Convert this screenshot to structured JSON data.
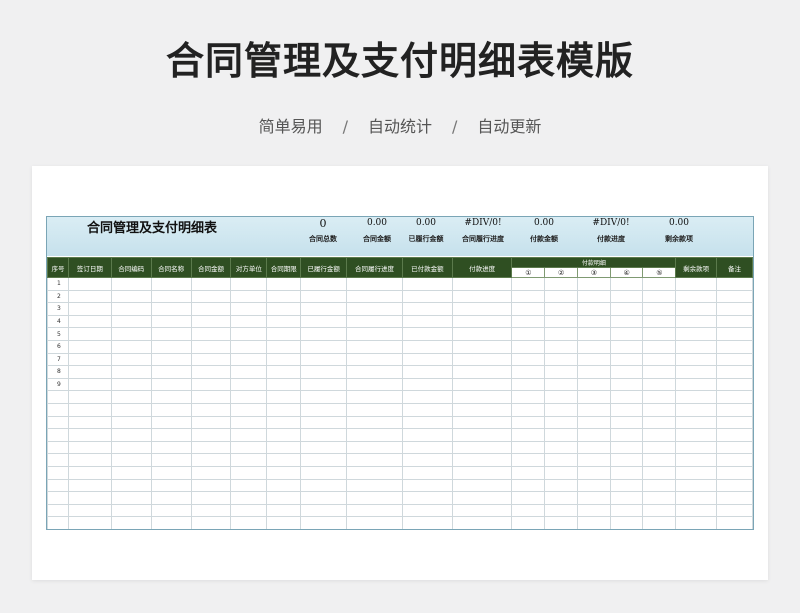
{
  "header": {
    "title": "合同管理及支付明细表模版",
    "features": [
      "简单易用",
      "自动统计",
      "自动更新"
    ],
    "separator": "/"
  },
  "sheet": {
    "title": "合同管理及支付明细表",
    "summary": [
      {
        "value": "0",
        "label": "合同总数"
      },
      {
        "value": "0.00",
        "label": "合同金额"
      },
      {
        "value": "0.00",
        "label": "已履行金额"
      },
      {
        "value": "#DIV/0!",
        "label": "合同履行进度"
      },
      {
        "value": "0.00",
        "label": "付款金额"
      },
      {
        "value": "#DIV/0!",
        "label": "付款进度"
      },
      {
        "value": "0.00",
        "label": "剩余款项"
      }
    ],
    "columns": [
      "序号",
      "签订日期",
      "合同编码",
      "合同名称",
      "合同金额",
      "对方单位",
      "合同期限",
      "已履行金额",
      "合同履行进度",
      "已付款金额",
      "付款进度",
      "付款明细",
      "剩余款项",
      "备注"
    ],
    "payment_subcols": [
      "①",
      "②",
      "③",
      "④",
      "⑤"
    ],
    "row_numbers": [
      "1",
      "2",
      "3",
      "4",
      "5",
      "6",
      "7",
      "8",
      "9"
    ]
  }
}
